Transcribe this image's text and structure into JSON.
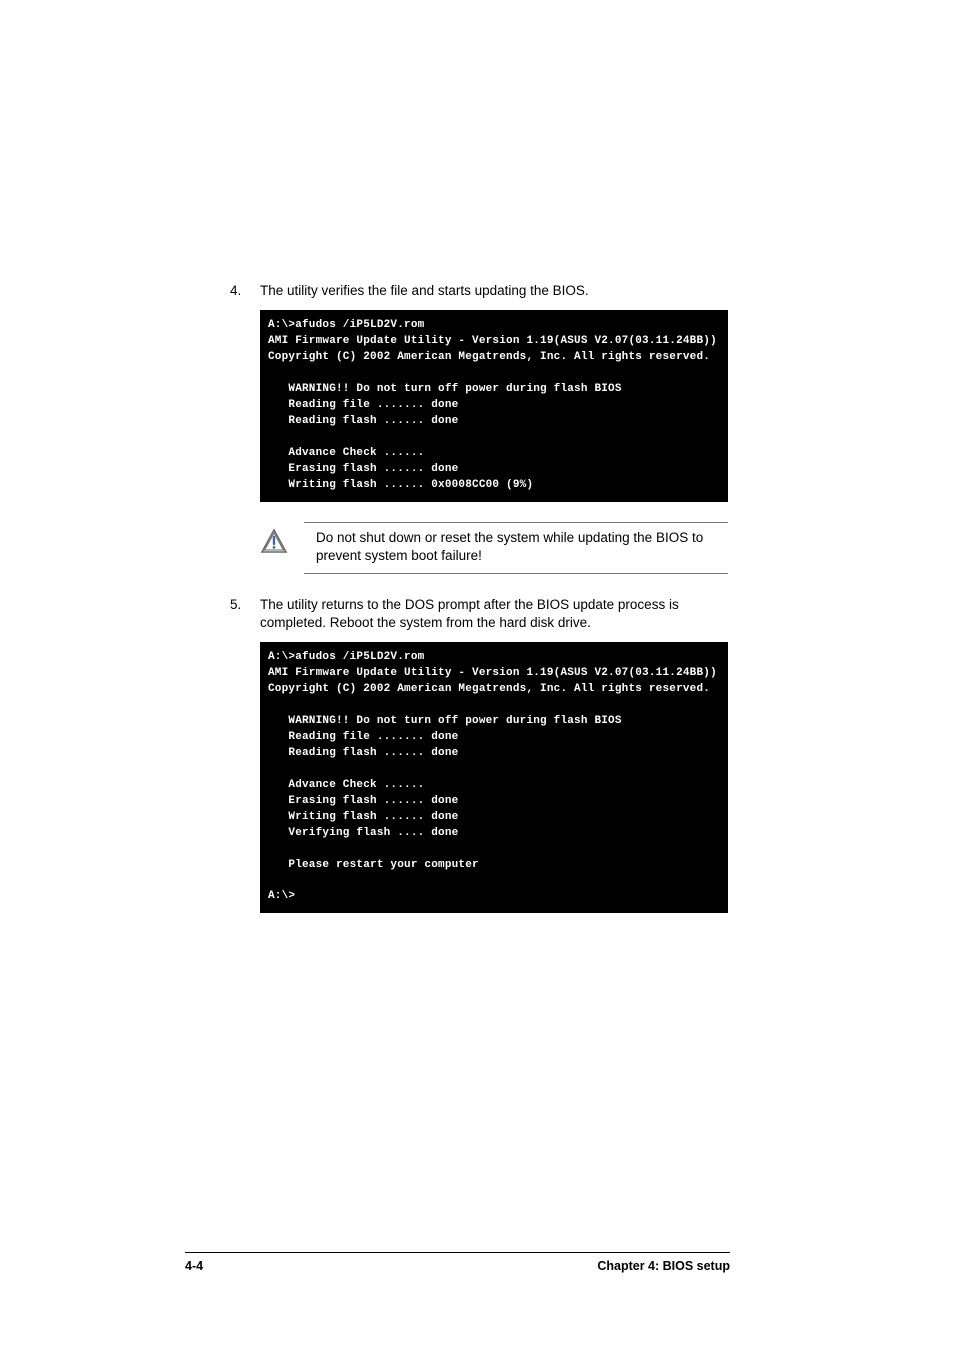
{
  "steps": {
    "s4": {
      "num": "4.",
      "text": "The utility verifies the file and starts updating the BIOS."
    },
    "s5": {
      "num": "5.",
      "text": "The utility returns to the DOS prompt after the BIOS update process is completed. Reboot the system from the hard disk drive."
    }
  },
  "terminals": {
    "t1": "A:\\>afudos /iP5LD2V.rom\nAMI Firmware Update Utility - Version 1.19(ASUS V2.07(03.11.24BB))\nCopyright (C) 2002 American Megatrends, Inc. All rights reserved.\n\n   WARNING!! Do not turn off power during flash BIOS\n   Reading file ....... done\n   Reading flash ...... done\n\n   Advance Check ......\n   Erasing flash ...... done\n   Writing flash ...... 0x0008CC00 (9%)",
    "t2": "A:\\>afudos /iP5LD2V.rom\nAMI Firmware Update Utility - Version 1.19(ASUS V2.07(03.11.24BB))\nCopyright (C) 2002 American Megatrends, Inc. All rights reserved.\n\n   WARNING!! Do not turn off power during flash BIOS\n   Reading file ....... done\n   Reading flash ...... done\n\n   Advance Check ......\n   Erasing flash ...... done\n   Writing flash ...... done\n   Verifying flash .... done\n\n   Please restart your computer\n\nA:\\>"
  },
  "callout": {
    "text": "Do not shut down or reset the system while updating the BIOS to prevent system boot failure!"
  },
  "footer": {
    "page": "4-4",
    "chapter": "Chapter 4: BIOS setup"
  }
}
